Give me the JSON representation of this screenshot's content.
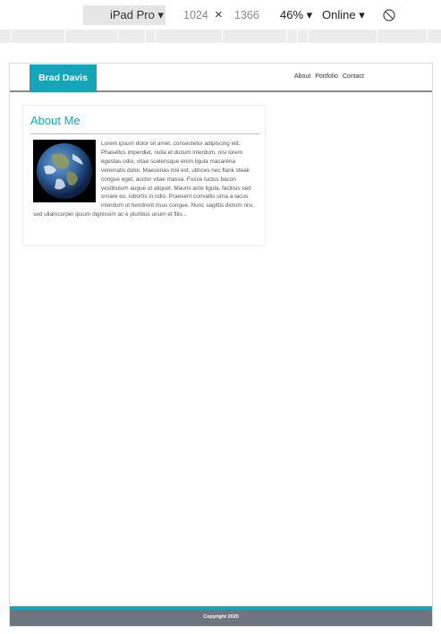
{
  "devtools": {
    "device": "iPad Pro ▾",
    "width": "1024",
    "times": "×",
    "height": "1366",
    "zoom": "46% ▾",
    "network": "Online ▾"
  },
  "site": {
    "brand": "Brad Davis",
    "nav": [
      "About",
      "Portfolio",
      "Contact"
    ],
    "about_title": "About Me",
    "about_text": "Lorem ipsum dolor sit amet, consectetur adipiscing elit. Phasellus imperdiet, nulla et dictum interdum, nisi lorem egestas odio, vitae scelerisque enim ligula macarena venenatis dolor. Maecenas nisl est, ultrices nec flank steak congue eget, auctor vitae massa. Fusce luctus bacon vestibulum augue ut aliquet. Mauris ante ligula, facilisis sed ornare eu, lobortis in odio. Praesent convallis urna a lacus interdum ut hendrerit risus congue. Nunc sagittis dictum nisi, sed ullamcorper ipsum dignissim ac e pluribus unum et filis...",
    "footer": "Copyright 2020"
  },
  "colors": {
    "accent": "#16a5b8",
    "footer_bg": "#6d767e"
  },
  "icons": {
    "rotate": "rotate-icon",
    "image": "earth-image"
  }
}
